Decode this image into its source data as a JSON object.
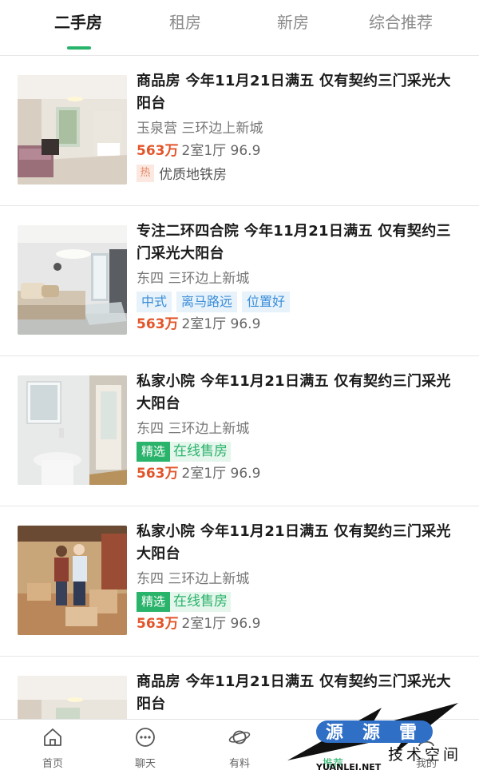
{
  "tabs": [
    {
      "label": "二手房",
      "active": true
    },
    {
      "label": "租房",
      "active": false
    },
    {
      "label": "新房",
      "active": false
    },
    {
      "label": "综合推荐",
      "active": false
    }
  ],
  "colors": {
    "accent": "#26b46a",
    "price": "#e2552a",
    "tag_blue": "#3b8ed8"
  },
  "listings": [
    {
      "title": "商品房 今年11月21日满五 仅有契约三门采光大阳台",
      "location": "玉泉营 三环边上新城",
      "price": "563万",
      "specs": "2室1厅 96.9",
      "hot_badge": "热",
      "hot_text": "优质地铁房"
    },
    {
      "title": "专注二环四合院 今年11月21日满五 仅有契约三门采光大阳台",
      "location": "东四 三环边上新城",
      "tags": [
        "中式",
        "离马路远",
        "位置好"
      ],
      "price": "563万",
      "specs": "2室1厅 96.9"
    },
    {
      "title": "私家小院 今年11月21日满五 仅有契约三门采光大阳台",
      "location": "东四 三环边上新城",
      "sel_a": "精选",
      "sel_b": "在线售房",
      "price": "563万",
      "specs": "2室1厅 96.9"
    },
    {
      "title": "私家小院 今年11月21日满五 仅有契约三门采光大阳台",
      "location": "东四 三环边上新城",
      "sel_a": "精选",
      "sel_b": "在线售房",
      "price": "563万",
      "specs": "2室1厅 96.9"
    },
    {
      "title": "商品房 今年11月21日满五 仅有契约三门采光大阳台"
    }
  ],
  "bottom_nav": [
    {
      "label": "首页",
      "icon": "home-icon"
    },
    {
      "label": "聊天",
      "icon": "chat-icon"
    },
    {
      "label": "有料",
      "icon": "planet-icon"
    },
    {
      "label": "推荐",
      "icon": "recommend-icon",
      "active": true
    },
    {
      "label": "我的",
      "icon": "profile-icon"
    }
  ],
  "watermark": {
    "logo_chars": [
      "源",
      "源",
      "雷"
    ],
    "text": "技术空间",
    "url": "YUANLEI.NET"
  }
}
